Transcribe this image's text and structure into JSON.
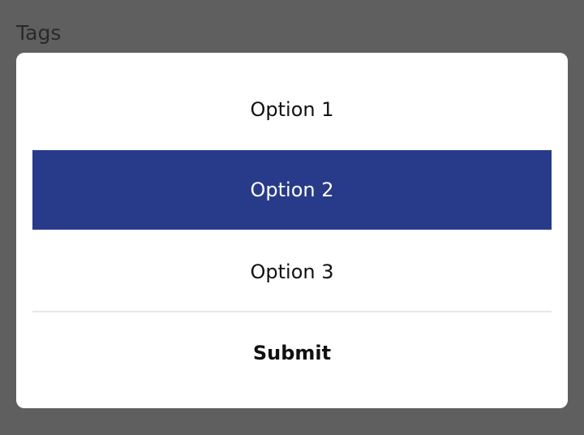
{
  "background": {
    "field_label": "Tags"
  },
  "dialog": {
    "options": [
      {
        "label": "Option 1",
        "selected": false
      },
      {
        "label": "Option 2",
        "selected": true
      },
      {
        "label": "Option 3",
        "selected": false
      }
    ],
    "submit_label": "Submit"
  },
  "colors": {
    "overlay": "#5f5f5f",
    "dialog_bg": "#ffffff",
    "selected_bg": "#283a8a",
    "selected_text": "#ffffff",
    "text": "#111111",
    "divider": "#e6e6e6"
  }
}
